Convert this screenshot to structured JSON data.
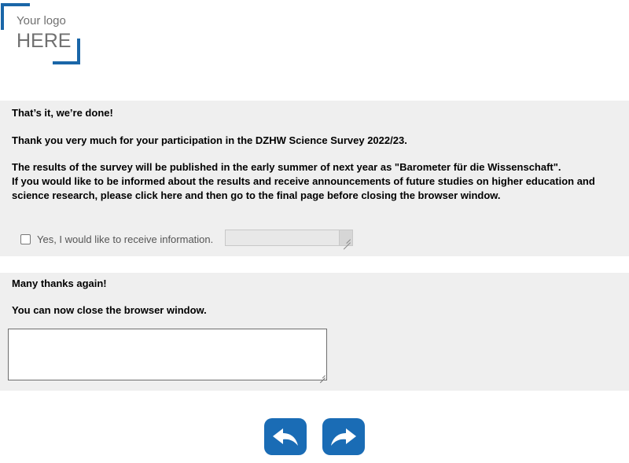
{
  "logo": {
    "line1": "Your logo",
    "line2": "HERE",
    "accent_color": "#1a66a8"
  },
  "section1": {
    "heading": "That’s it, we’re done!",
    "thanks": "Thank you very much for your participation in the DZHW Science Survey 2022/23.",
    "results_line1": "The results of the survey will be published in the early summer of next year as \"Barometer für die Wissenschaft\".",
    "results_line2": "If you would like to be informed about the results and receive announcements of future studies on higher education and",
    "results_line3": "science research, please click here and then go to the final page before closing the browser window.",
    "checkbox_label": "Yes, I would like to receive information.",
    "checkbox_checked": false,
    "info_field_value": ""
  },
  "section2": {
    "thanks_again": "Many thanks again!",
    "close_text": "You can now close the browser window.",
    "comment_value": ""
  },
  "navigation": {
    "back_icon": "back-arrow-icon",
    "forward_icon": "forward-arrow-icon",
    "button_color": "#1a6cb5"
  }
}
